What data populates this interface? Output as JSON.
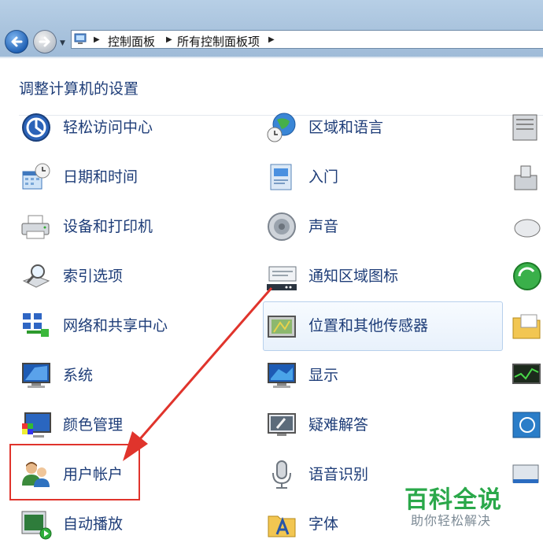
{
  "address_bar": {
    "crumbs": [
      "控制面板",
      "所有控制面板项"
    ]
  },
  "heading": "调整计算机的设置",
  "items": {
    "ease_access": "轻松访问中心",
    "region_lang": "区域和语言",
    "datetime": "日期和时间",
    "getting_started": "入门",
    "devices_printers": "设备和打印机",
    "sound": "声音",
    "indexing": "索引选项",
    "notification_icons": "通知区域图标",
    "network_center": "网络和共享中心",
    "location_sensors": "位置和其他传感器",
    "system": "系统",
    "display": "显示",
    "color_mgmt": "颜色管理",
    "troubleshoot": "疑难解答",
    "user_accounts": "用户帐户",
    "speech": "语音识别",
    "autoplay": "自动播放",
    "fonts": "字体"
  },
  "watermark": {
    "title": "百科全说",
    "subtitle": "助你轻松解决"
  },
  "colors": {
    "link": "#1e3d78",
    "highlight_box": "#e0342c",
    "arrow": "#e0342c",
    "watermark": "#2aa84a"
  }
}
